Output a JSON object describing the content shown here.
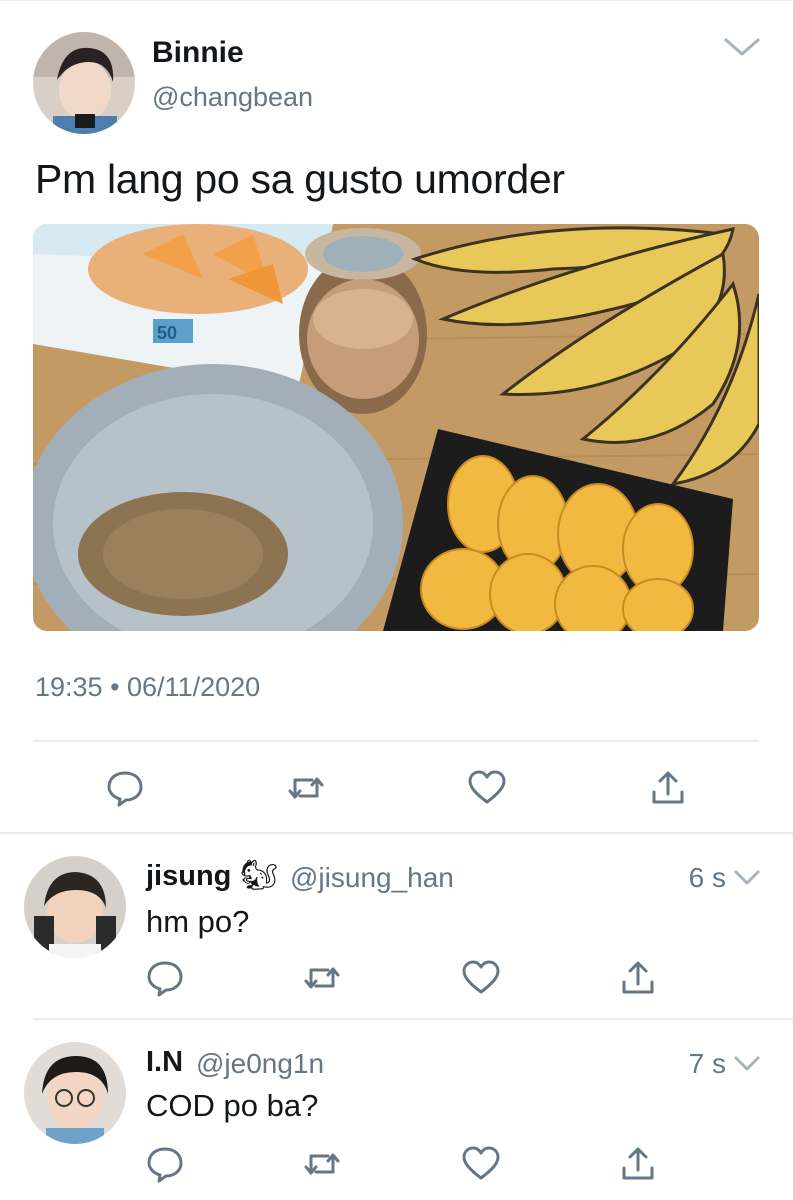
{
  "tweet": {
    "display_name": "Binnie",
    "handle": "@changbean",
    "text": "Pm lang po sa gusto umorder",
    "timestamp": "19:35 • 06/11/2020",
    "media": {
      "tray_price_label": "50"
    },
    "actions": [
      "reply",
      "retweet",
      "like",
      "share"
    ]
  },
  "replies": [
    {
      "display_name": "jisung",
      "emoji": "🐿",
      "handle": "@jisung_han",
      "time": "6 s",
      "text": "hm po?"
    },
    {
      "display_name": "I.N",
      "handle": "@je0ng1n",
      "time": "7 s",
      "text": "COD po ba?"
    }
  ],
  "colors": {
    "text": "#14171a",
    "secondary": "#657786",
    "separator": "#e6ecf0",
    "icon": "#657786"
  }
}
